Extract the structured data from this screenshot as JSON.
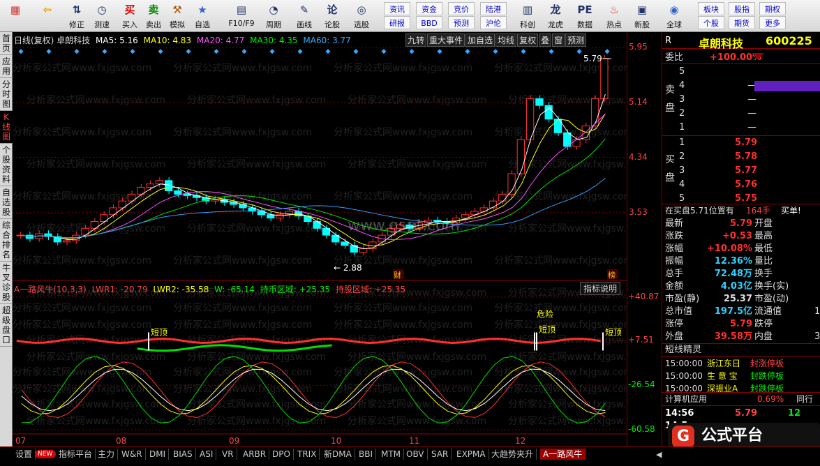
{
  "toolbar": {
    "buttons": [
      {
        "label": "",
        "icon": "grid-icon"
      },
      {
        "label": "",
        "icon": "back-icon"
      },
      {
        "label": "修正",
        "icon": "up-down-icon"
      },
      {
        "label": "测速",
        "icon": "clock-icon"
      },
      {
        "label": "买入",
        "icon": "buy-icon"
      },
      {
        "label": "卖出",
        "icon": "sell-icon"
      },
      {
        "label": "模拟",
        "icon": "hammer-icon"
      },
      {
        "label": "自选",
        "icon": "star-icon"
      },
      {
        "label": "F10/F9",
        "icon": "f10-icon"
      },
      {
        "label": "周期",
        "icon": "cycle-icon"
      },
      {
        "label": "画线",
        "icon": "pen-icon"
      },
      {
        "label": "论股",
        "icon": "discuss-icon"
      },
      {
        "label": "选股",
        "icon": "pick-icon"
      },
      {
        "label": "科创",
        "icon": "tech-icon"
      },
      {
        "label": "龙虎",
        "icon": "dragon-icon"
      },
      {
        "label": "数据",
        "icon": "pe-icon"
      },
      {
        "label": "热点",
        "icon": "hot-icon"
      },
      {
        "label": "新股",
        "icon": "new-stock-icon"
      },
      {
        "label": "全球",
        "icon": "globe-icon"
      }
    ],
    "small_buttons": [
      [
        "资讯",
        "资金",
        "竞价",
        "陆港"
      ],
      [
        "研报",
        "BBD",
        "预测",
        "沪伦"
      ]
    ],
    "right_buttons": [
      [
        "板块",
        "股指",
        "期权"
      ],
      [
        "个股",
        "期货",
        "更多"
      ]
    ]
  },
  "left_nav": [
    "首页",
    "应用",
    "分时图",
    "K线图",
    "个股资料",
    "自选股",
    "综合排名",
    "牛叉诊股",
    "超级盘口"
  ],
  "chart_header": {
    "stock": "日线(复权) 卓朗科技",
    "ma5": "MA5: 5.16",
    "ma10": "MA10: 4.83",
    "ma20": "MA20: 4.77",
    "ma30": "MA30: 4.35",
    "ma60": "MA60: 3.77"
  },
  "chart_tools": [
    "九转",
    "重大事件",
    "加自选",
    "均线",
    "复权",
    "叠",
    "窗",
    "预测"
  ],
  "watermark": "分析家公式网www.fxjgsw.com",
  "site_watermark": "www.gspt.com",
  "price_labels": {
    "high": "5.79",
    "low": "2.88"
  },
  "markers": {
    "cai": "财",
    "bang": "榜"
  },
  "price_axis": [
    "5.95",
    "5.14",
    "4.34",
    "3.53"
  ],
  "indicator": {
    "title": "A一路风牛(10,3,3)",
    "lwr1": "LWR1: -20.79",
    "lwr2": "LWR2: -35.58",
    "w": "W: -65.14",
    "hold_coin": "持币区域: +25.35",
    "hold_stock": "持股区域: +25.35",
    "explain": "指标说明",
    "annotations": [
      "短顶",
      "危险",
      "短顶",
      "短顶"
    ]
  },
  "indicator_axis": [
    "+40.87",
    "+7.51",
    "-26.54",
    "-60.58"
  ],
  "months": [
    "07",
    "08",
    "09",
    "10",
    "11",
    "12"
  ],
  "bottom_tabs": [
    "设置",
    "NEW",
    "指标平台",
    "主力",
    "W&R",
    "DMI",
    "BIAS",
    "ASI",
    "VR",
    "ARBR",
    "DPO",
    "TRIX",
    "新DMA",
    "BBI",
    "MTM",
    "OBV",
    "SAR",
    "EXPMA",
    "大趋势夹升",
    "A一路风牛"
  ],
  "quote": {
    "code": "R",
    "name": "卓朗科技",
    "number": "600225",
    "weibi_label": "委比",
    "weibi": "+100.00%",
    "sell_label": "卖盘",
    "sells": [
      [
        "5",
        "",
        ""
      ],
      [
        "4",
        "",
        "—"
      ],
      [
        "3",
        "",
        "—"
      ],
      [
        "2",
        "",
        "—"
      ],
      [
        "1",
        "",
        "—"
      ]
    ],
    "buy_label": "买盘",
    "buys": [
      [
        "1",
        "5.79",
        ""
      ],
      [
        "2",
        "5.78",
        ""
      ],
      [
        "3",
        "5.77",
        ""
      ],
      [
        "4",
        "5.76",
        ""
      ],
      [
        "5",
        "5.75",
        ""
      ]
    ],
    "pos_line": "在买盘5.71位置有",
    "pos_hand": "164手",
    "buy_one": "买单!",
    "stats": [
      [
        "最新",
        "5.79",
        "开盘",
        ""
      ],
      [
        "涨跌",
        "+0.53",
        "最高",
        ""
      ],
      [
        "涨幅",
        "+10.08%",
        "最低",
        ""
      ],
      [
        "振幅",
        "12.36%",
        "量比",
        ""
      ],
      [
        "总手",
        "72.48万",
        "换手",
        ""
      ],
      [
        "金额",
        "4.03亿",
        "换手(实)",
        ""
      ],
      [
        "市盈(静)",
        "25.37",
        "市盈(动)",
        ""
      ],
      [
        "总市值",
        "197.5亿",
        "流通值",
        "1"
      ],
      [
        "涨停",
        "5.79",
        "跌停",
        ""
      ],
      [
        "外盘",
        "39.58万",
        "内盘",
        "3"
      ]
    ],
    "short_title": "短线精灵",
    "short_list": [
      [
        "15:00:00",
        "浙江东日",
        "封涨停板"
      ],
      [
        "15:00:00",
        "生 意 宝",
        "封跌停板"
      ],
      [
        "15:00:00",
        "深振业A",
        "封跌停板"
      ]
    ],
    "sector": "计算机应用",
    "sector_pct": "0.69%",
    "sector_next": "同行",
    "ticks": [
      [
        "14:56",
        "5.79",
        "12"
      ],
      [
        "14:5",
        "",
        ""
      ]
    ],
    "logo_text": "公式平台",
    "logo_url": "www.gspt.com"
  },
  "colors": {
    "up": "#ff3030",
    "down": "#00ffff",
    "ma5": "#ffffff",
    "ma10": "#ffff00",
    "ma20": "#ff50ff",
    "ma30": "#00e000",
    "ma60": "#30a0ff"
  },
  "chart_data": {
    "type": "candlestick",
    "x": [
      "07",
      "08",
      "09",
      "10",
      "11",
      "12"
    ],
    "ylim": [
      2.7,
      5.95
    ],
    "y_ticks": [
      5.95,
      5.14,
      4.34,
      3.53
    ],
    "close": [
      3.2,
      3.15,
      3.22,
      3.18,
      3.1,
      3.12,
      3.2,
      3.3,
      3.4,
      3.5,
      3.6,
      3.7,
      3.8,
      3.9,
      3.95,
      4.0,
      3.85,
      3.8,
      3.78,
      3.75,
      3.7,
      3.72,
      3.68,
      3.65,
      3.6,
      3.55,
      3.5,
      3.45,
      3.5,
      3.55,
      3.48,
      3.4,
      3.3,
      3.2,
      3.1,
      3.05,
      2.95,
      3.0,
      3.1,
      3.2,
      3.3,
      3.35,
      3.3,
      3.38,
      3.42,
      3.4,
      3.38,
      3.45,
      3.5,
      3.55,
      3.6,
      3.7,
      3.8,
      4.1,
      4.6,
      5.2,
      5.1,
      4.9,
      4.7,
      4.5,
      4.6,
      4.8,
      5.2,
      5.79
    ],
    "high": 5.79,
    "low": 2.88,
    "indicator": {
      "axis": [
        40.87,
        7.51,
        -26.54,
        -60.58
      ]
    }
  }
}
